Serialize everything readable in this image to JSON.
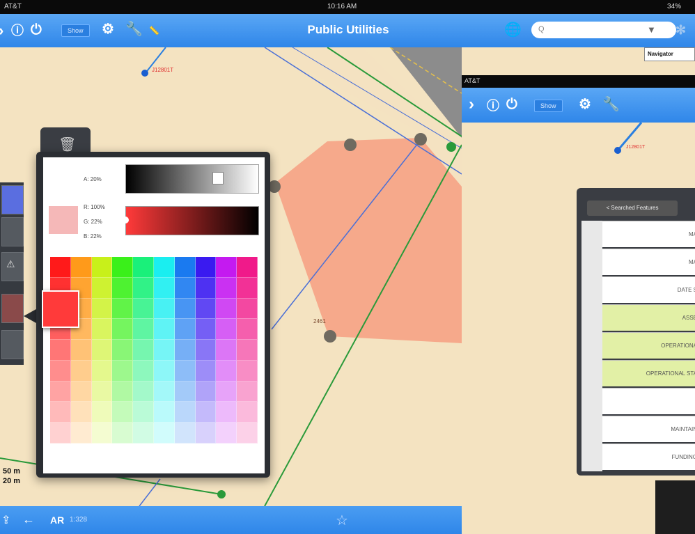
{
  "status_bar": {
    "carrier": "AT&T",
    "time": "10:16 AM",
    "battery": "34%"
  },
  "toolbar": {
    "title": "Public Utilities",
    "show_label": "Show",
    "search_placeholder": "Q"
  },
  "navigator": {
    "label": "Navigator"
  },
  "map": {
    "labels": {
      "feature_id_1": "J12801T",
      "node_label": "2461",
      "scale_top": "50 m",
      "scale_bottom": "20 m"
    }
  },
  "bottombar": {
    "ar_label": "AR",
    "scale_text": "1:328"
  },
  "color_picker": {
    "alpha_label": "A: 20%",
    "r_label": "R: 100%",
    "g_label": "G: 22%",
    "b_label": "B: 22%",
    "selected_color": "#ff3a3a",
    "palette_hues": [
      "#ff1a1a",
      "#ff9a1a",
      "#c8f01a",
      "#3af01a",
      "#1af07a",
      "#1aeef0",
      "#1a7af0",
      "#3a1af0",
      "#c41af0",
      "#f01a8a"
    ]
  },
  "phone": {
    "status_carrier": "AT&T",
    "feature_id": "J12801T",
    "back_button": "< Searched Features",
    "rows": [
      "MA",
      "MA",
      "DATE S",
      "ASSE",
      "OPERATIONA",
      "OPERATIONAL STA",
      "",
      "MAINTAIN",
      "FUNDING"
    ]
  }
}
